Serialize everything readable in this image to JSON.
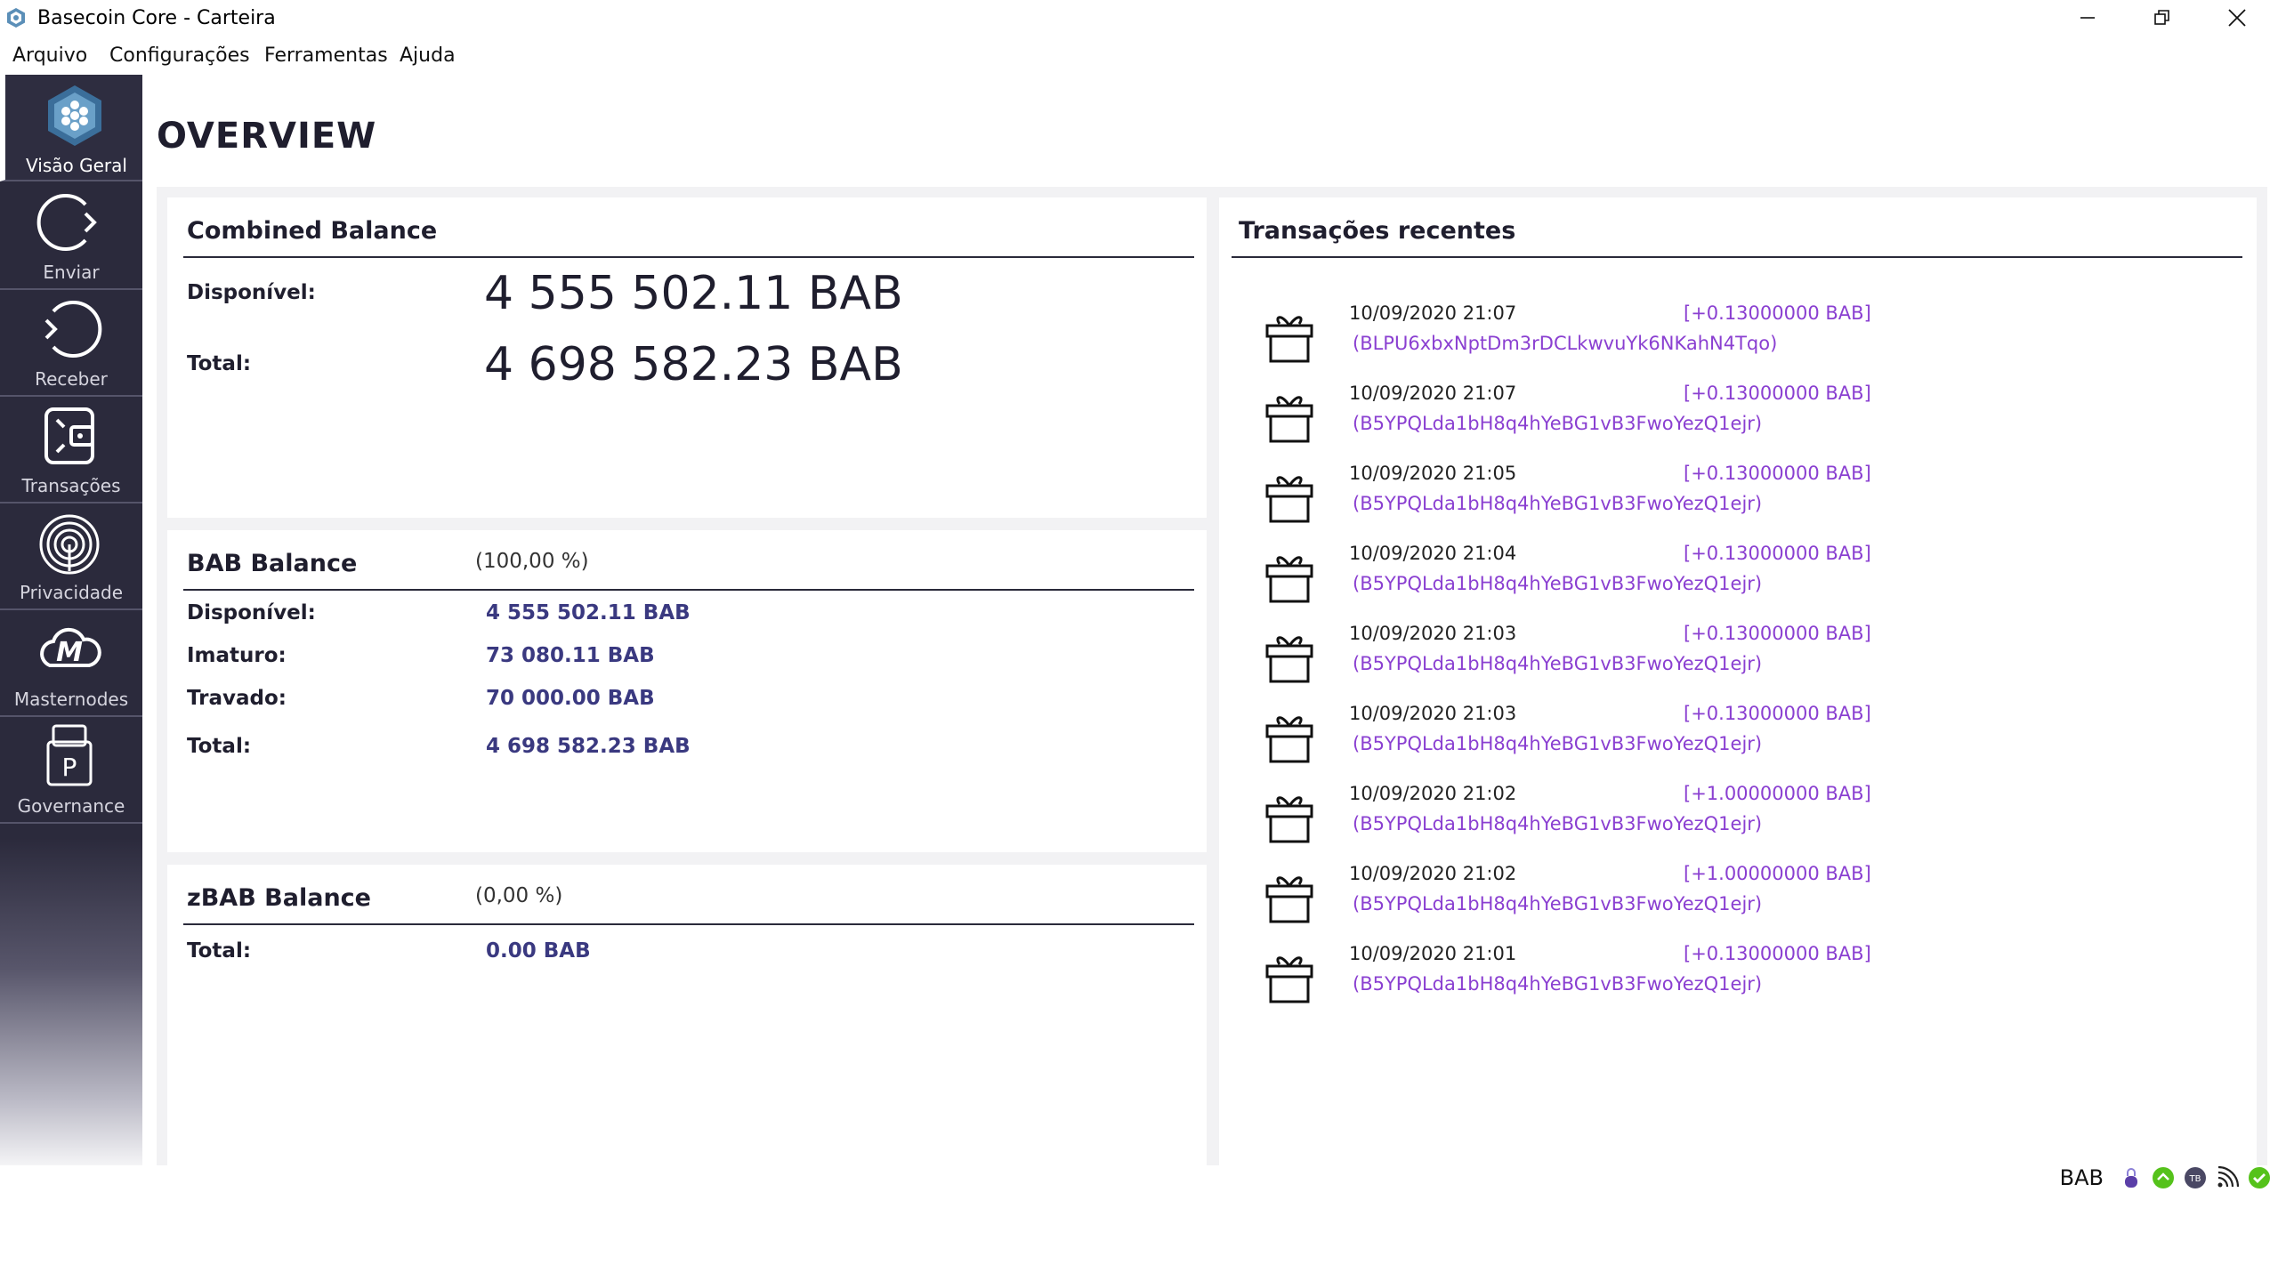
{
  "window": {
    "title": "Basecoin Core - Carteira"
  },
  "menu": [
    "Arquivo",
    "Configurações",
    "Ferramentas",
    "Ajuda"
  ],
  "sidebar": {
    "items": [
      {
        "label": "Visão Geral",
        "icon": "hexagon-logo-icon",
        "active": true
      },
      {
        "label": "Enviar",
        "icon": "send-arrow-icon"
      },
      {
        "label": "Receber",
        "icon": "receive-arrow-icon"
      },
      {
        "label": "Transações",
        "icon": "wallet-exchange-icon"
      },
      {
        "label": "Privacidade",
        "icon": "fingerprint-icon"
      },
      {
        "label": "Masternodes",
        "icon": "cloud-m-icon"
      },
      {
        "label": "Governance",
        "icon": "document-p-icon"
      }
    ]
  },
  "page": {
    "title": "OVERVIEW"
  },
  "combined": {
    "header": "Combined Balance",
    "available_label": "Disponível:",
    "available_value": "4 555 502.11 BAB",
    "total_label": "Total:",
    "total_value": "4 698 582.23 BAB"
  },
  "bab": {
    "header": "BAB Balance",
    "pct": "(100,00 %)",
    "available_label": "Disponível:",
    "available_value": "4 555 502.11 BAB",
    "immature_label": "Imaturo:",
    "immature_value": "73 080.11 BAB",
    "locked_label": "Travado:",
    "locked_value": "70 000.00 BAB",
    "total_label": "Total:",
    "total_value": "4 698 582.23 BAB"
  },
  "zbab": {
    "header": "zBAB Balance",
    "pct": "(0,00 %)",
    "total_label": "Total:",
    "total_value": "0.00 BAB"
  },
  "recent": {
    "header": "Transações recentes",
    "items": [
      {
        "date": "10/09/2020 21:07",
        "amount": "[+0.13000000 BAB]",
        "address": "(BLPU6xbxNptDm3rDCLkwvuYk6NKahN4Tqo)"
      },
      {
        "date": "10/09/2020 21:07",
        "amount": "[+0.13000000 BAB]",
        "address": "(B5YPQLda1bH8q4hYeBG1vB3FwoYezQ1ejr)"
      },
      {
        "date": "10/09/2020 21:05",
        "amount": "[+0.13000000 BAB]",
        "address": "(B5YPQLda1bH8q4hYeBG1vB3FwoYezQ1ejr)"
      },
      {
        "date": "10/09/2020 21:04",
        "amount": "[+0.13000000 BAB]",
        "address": "(B5YPQLda1bH8q4hYeBG1vB3FwoYezQ1ejr)"
      },
      {
        "date": "10/09/2020 21:03",
        "amount": "[+0.13000000 BAB]",
        "address": "(B5YPQLda1bH8q4hYeBG1vB3FwoYezQ1ejr)"
      },
      {
        "date": "10/09/2020 21:03",
        "amount": "[+0.13000000 BAB]",
        "address": "(B5YPQLda1bH8q4hYeBG1vB3FwoYezQ1ejr)"
      },
      {
        "date": "10/09/2020 21:02",
        "amount": "[+1.00000000 BAB]",
        "address": "(B5YPQLda1bH8q4hYeBG1vB3FwoYezQ1ejr)"
      },
      {
        "date": "10/09/2020 21:02",
        "amount": "[+1.00000000 BAB]",
        "address": "(B5YPQLda1bH8q4hYeBG1vB3FwoYezQ1ejr)"
      },
      {
        "date": "10/09/2020 21:01",
        "amount": "[+0.13000000 BAB]",
        "address": "(B5YPQLda1bH8q4hYeBG1vB3FwoYezQ1ejr)"
      }
    ]
  },
  "statusbar": {
    "unit": "BAB",
    "tor_badge": "TB"
  },
  "colors": {
    "sidebar": "#2b2a3c",
    "accent": "#8a3fd1",
    "balance_value": "#3a3980",
    "ok": "#55c21b"
  }
}
